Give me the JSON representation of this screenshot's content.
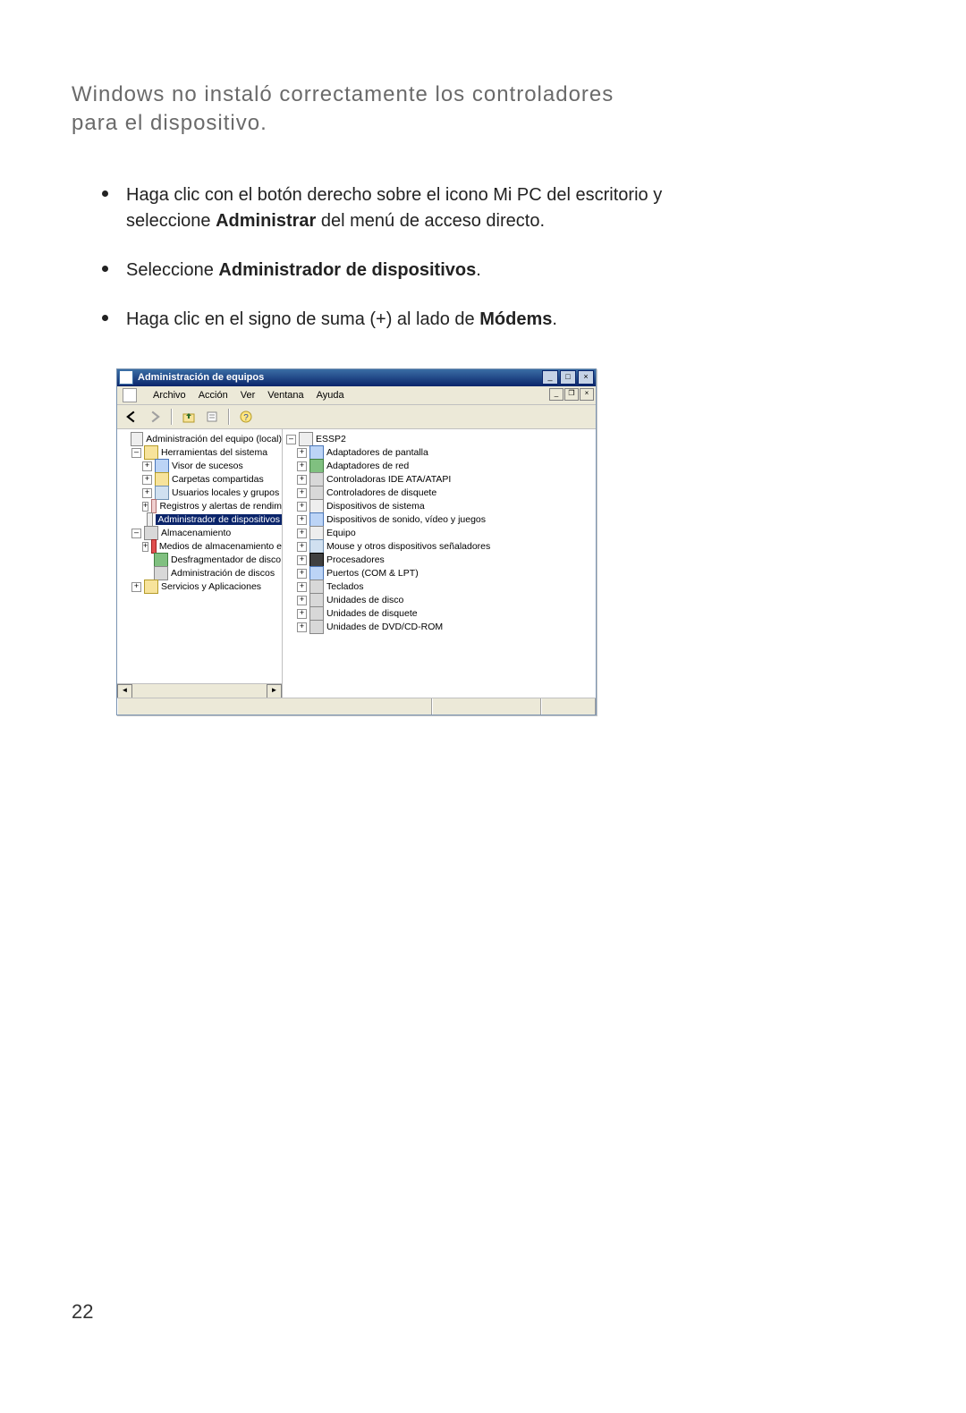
{
  "heading": "Windows no instaló correctamente los controladores para el dispositivo.",
  "bullets": {
    "b1_pre": "Haga clic con el botón derecho sobre el icono Mi PC del escritorio y seleccione ",
    "b1_bold": "Administrar",
    "b1_post": " del menú de acceso directo.",
    "b2_pre": "Seleccione ",
    "b2_bold": "Administrador de dispositivos",
    "b2_post": ".",
    "b3_pre": "Haga clic en el signo de suma (+) al lado de ",
    "b3_bold": "Módems",
    "b3_post": "."
  },
  "page_number": "22",
  "window": {
    "title": "Administración de equipos",
    "menu": {
      "archivo": "Archivo",
      "accion": "Acción",
      "ver": "Ver",
      "ventana": "Ventana",
      "ayuda": "Ayuda"
    },
    "expanders": {
      "minus": "–",
      "plus": "+"
    },
    "left_tree": [
      {
        "ind": 0,
        "ex": "",
        "icon": "c-comp",
        "label": "Administración del equipo (local)",
        "sel": false
      },
      {
        "ind": 1,
        "ex": "–",
        "icon": "c-tool",
        "label": "Herramientas del sistema",
        "sel": false
      },
      {
        "ind": 2,
        "ex": "+",
        "icon": "c-blue",
        "label": "Visor de sucesos",
        "sel": false
      },
      {
        "ind": 2,
        "ex": "+",
        "icon": "c-fold",
        "label": "Carpetas compartidas",
        "sel": false
      },
      {
        "ind": 2,
        "ex": "+",
        "icon": "c-user",
        "label": "Usuarios locales y grupos",
        "sel": false
      },
      {
        "ind": 2,
        "ex": "+",
        "icon": "c-log",
        "label": "Registros y alertas de rendim",
        "sel": false
      },
      {
        "ind": 2,
        "ex": "",
        "icon": "c-comp",
        "label": "Administrador de dispositivos",
        "sel": true
      },
      {
        "ind": 1,
        "ex": "–",
        "icon": "c-disk",
        "label": "Almacenamiento",
        "sel": false
      },
      {
        "ind": 2,
        "ex": "+",
        "icon": "c-red",
        "label": "Medios de almacenamiento e",
        "sel": false
      },
      {
        "ind": 2,
        "ex": "",
        "icon": "c-grn",
        "label": "Desfragmentador de disco",
        "sel": false
      },
      {
        "ind": 2,
        "ex": "",
        "icon": "c-disk",
        "label": "Administración de discos",
        "sel": false
      },
      {
        "ind": 1,
        "ex": "+",
        "icon": "c-tool",
        "label": "Servicios y Aplicaciones",
        "sel": false
      }
    ],
    "right_tree": {
      "root": "ESSP2",
      "items": [
        {
          "icon": "c-blue",
          "label": "Adaptadores de pantalla"
        },
        {
          "icon": "c-grn",
          "label": "Adaptadores de red"
        },
        {
          "icon": "c-disk",
          "label": "Controladoras IDE ATA/ATAPI"
        },
        {
          "icon": "c-disk",
          "label": "Controladores de disquete"
        },
        {
          "icon": "c-comp",
          "label": "Dispositivos de sistema"
        },
        {
          "icon": "c-blue",
          "label": "Dispositivos de sonido, vídeo y juegos"
        },
        {
          "icon": "c-comp",
          "label": "Equipo"
        },
        {
          "icon": "c-user",
          "label": "Mouse y otros dispositivos señaladores"
        },
        {
          "icon": "c-cpu",
          "label": "Procesadores"
        },
        {
          "icon": "c-blue",
          "label": "Puertos (COM & LPT)"
        },
        {
          "icon": "c-disk",
          "label": "Teclados"
        },
        {
          "icon": "c-disk",
          "label": "Unidades de disco"
        },
        {
          "icon": "c-disk",
          "label": "Unidades de disquete"
        },
        {
          "icon": "c-disk",
          "label": "Unidades de DVD/CD-ROM"
        }
      ]
    }
  }
}
